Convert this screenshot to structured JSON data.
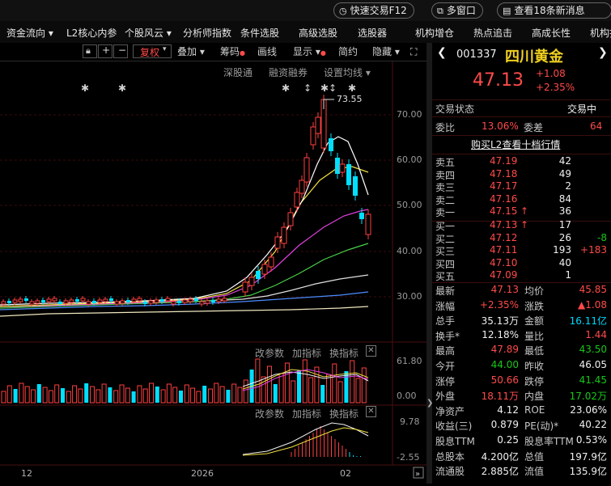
{
  "topbar": {
    "quick_trade": "快速交易F12",
    "multi_window": "多窗口",
    "news": "查看18条新消息"
  },
  "menu": [
    "资金流向 ▾",
    "L2核心内参",
    "个股风云 ▾",
    "分析师指数",
    "条件选股",
    "高级选股",
    "选股器",
    "机构增仓",
    "热点追击",
    "高成长性",
    "机构持"
  ],
  "toolbar": {
    "fuquan": "复权",
    "diejia": "叠加",
    "chouma": "筹码",
    "huaxian": "画线",
    "xianshi": "显示",
    "jianyue": "简约",
    "yincang": "隐藏"
  },
  "overlay": {
    "sgt": "深股通",
    "rzrq": "融资融券",
    "set_ma": "设置均线"
  },
  "price_axis": [
    "70.00",
    "60.00",
    "50.00",
    "40.00",
    "30.00"
  ],
  "max_label": "73.55",
  "vol_panel": {
    "params": "改参数",
    "add_ind": "加指标",
    "switch_ind": "换指标",
    "ticks": [
      "61.80",
      "0.00"
    ]
  },
  "macd_panel": {
    "params": "改参数",
    "add_ind": "加指标",
    "switch_ind": "换指标",
    "ticks": [
      "9.78",
      "-2.55"
    ]
  },
  "time_axis": [
    "12",
    "2026",
    "02"
  ],
  "stock": {
    "code": "001337",
    "name": "四川黄金",
    "price": "47.13",
    "change": "+1.08",
    "change_pct": "+2.35%",
    "status_label": "交易状态",
    "status_value": "交易中",
    "weibi_label": "委比",
    "weibi": "13.06%",
    "weicha_label": "委差",
    "weicha": "64",
    "l2_link": "购买L2查看十档行情"
  },
  "asks": [
    {
      "label": "卖五",
      "price": "47.19",
      "vol": "42",
      "chg": ""
    },
    {
      "label": "卖四",
      "price": "47.18",
      "vol": "49",
      "chg": ""
    },
    {
      "label": "卖三",
      "price": "47.17",
      "vol": "2",
      "chg": ""
    },
    {
      "label": "卖二",
      "price": "47.16",
      "vol": "84",
      "chg": ""
    },
    {
      "label": "卖一",
      "price": "47.15",
      "vol": "36",
      "chg": ""
    }
  ],
  "bids": [
    {
      "label": "买一",
      "price": "47.13",
      "vol": "17",
      "chg": ""
    },
    {
      "label": "买二",
      "price": "47.12",
      "vol": "26",
      "chg": "-8"
    },
    {
      "label": "买三",
      "price": "47.11",
      "vol": "193",
      "chg": "+183"
    },
    {
      "label": "买四",
      "price": "47.10",
      "vol": "40",
      "chg": ""
    },
    {
      "label": "买五",
      "price": "47.09",
      "vol": "1",
      "chg": ""
    }
  ],
  "stats": [
    {
      "l1": "最新",
      "v1": "47.13",
      "c1": "red",
      "l2": "均价",
      "v2": "45.85",
      "c2": "red"
    },
    {
      "l1": "涨幅",
      "v1": "+2.35%",
      "c1": "red",
      "l2": "涨跌",
      "v2": "▲1.08",
      "c2": "red"
    },
    {
      "l1": "总手",
      "v1": "35.13万",
      "c1": "white",
      "l2": "金额",
      "v2": "16.11亿",
      "c2": "cyan"
    },
    {
      "l1": "换手*",
      "v1": "12.18%",
      "c1": "white",
      "l2": "量比",
      "v2": "1.44",
      "c2": "red"
    },
    {
      "l1": "最高",
      "v1": "47.89",
      "c1": "red",
      "l2": "最低",
      "v2": "43.50",
      "c2": "green"
    },
    {
      "l1": "今开",
      "v1": "44.00",
      "c1": "green",
      "l2": "昨收",
      "v2": "46.05",
      "c2": "white"
    },
    {
      "l1": "涨停",
      "v1": "50.66",
      "c1": "red",
      "l2": "跌停",
      "v2": "41.45",
      "c2": "green"
    },
    {
      "l1": "外盘",
      "v1": "18.11万",
      "c1": "red",
      "l2": "内盘",
      "v2": "17.02万",
      "c2": "green"
    },
    {
      "l1": "净资产",
      "v1": "4.12",
      "c1": "white",
      "l2": "ROE",
      "v2": "23.06%",
      "c2": "white"
    },
    {
      "l1": "收益(三)",
      "v1": "0.879",
      "c1": "white",
      "l2": "PE(动)*",
      "v2": "40.22",
      "c2": "white"
    },
    {
      "l1": "股息TTM",
      "v1": "0.25",
      "c1": "white",
      "l2": "股息率TTM",
      "v2": "0.53%",
      "c2": "white"
    },
    {
      "l1": "总股本",
      "v1": "4.200亿",
      "c1": "white",
      "l2": "总值",
      "v2": "197.9亿",
      "c2": "white"
    },
    {
      "l1": "流通股",
      "v1": "2.885亿",
      "c1": "white",
      "l2": "流值",
      "v2": "135.9亿",
      "c2": "white"
    }
  ]
}
